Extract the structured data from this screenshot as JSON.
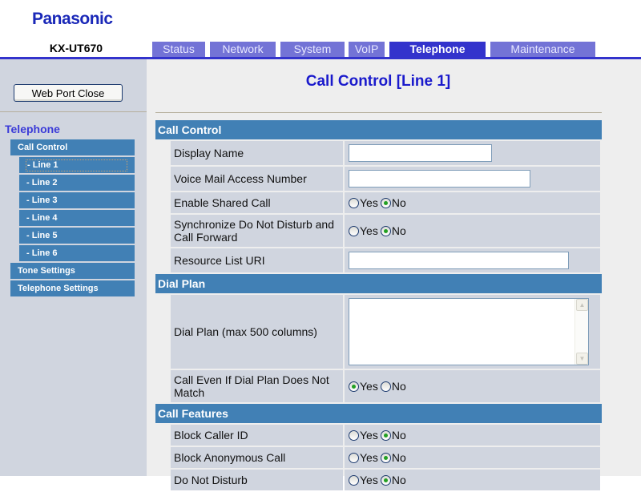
{
  "header": {
    "brand": "Panasonic",
    "model": "KX-UT670"
  },
  "tabs": [
    {
      "label": "Status",
      "active": false
    },
    {
      "label": "Network",
      "active": false
    },
    {
      "label": "System",
      "active": false
    },
    {
      "label": "VoIP",
      "active": false
    },
    {
      "label": "Telephone",
      "active": true
    },
    {
      "label": "Maintenance",
      "active": false
    }
  ],
  "sidebar": {
    "web_port_close": "Web Port Close",
    "section": "Telephone",
    "items": [
      {
        "label": "Call Control",
        "level": 0
      },
      {
        "label": "- Line 1",
        "level": 1,
        "current": true
      },
      {
        "label": "- Line 2",
        "level": 1
      },
      {
        "label": "- Line 3",
        "level": 1
      },
      {
        "label": "- Line 4",
        "level": 1
      },
      {
        "label": "- Line 5",
        "level": 1
      },
      {
        "label": "- Line 6",
        "level": 1
      },
      {
        "label": "Tone Settings",
        "level": 0
      },
      {
        "label": "Telephone Settings",
        "level": 0
      }
    ]
  },
  "page": {
    "title": "Call Control [Line 1]"
  },
  "radio_labels": {
    "yes": "Yes",
    "no": "No"
  },
  "sections": [
    {
      "title": "Call Control",
      "rows": [
        {
          "label": "Display Name",
          "type": "text",
          "value": ""
        },
        {
          "label": "Voice Mail Access Number",
          "type": "text",
          "value": ""
        },
        {
          "label": "Enable Shared Call",
          "type": "radio",
          "value": "No"
        },
        {
          "label": "Synchronize Do Not Disturb and Call Forward",
          "type": "radio",
          "value": "No"
        },
        {
          "label": "Resource List URI",
          "type": "text",
          "value": ""
        }
      ]
    },
    {
      "title": "Dial Plan",
      "rows": [
        {
          "label": "Dial Plan (max 500 columns)",
          "type": "textarea",
          "value": ""
        },
        {
          "label": "Call Even If Dial Plan Does Not Match",
          "type": "radio",
          "value": "Yes"
        }
      ]
    },
    {
      "title": "Call Features",
      "rows": [
        {
          "label": "Block Caller ID",
          "type": "radio",
          "value": "No"
        },
        {
          "label": "Block Anonymous Call",
          "type": "radio",
          "value": "No"
        },
        {
          "label": "Do Not Disturb",
          "type": "radio",
          "value": "No"
        }
      ]
    }
  ],
  "colors": {
    "tab_inactive": "#7373d6",
    "tab_active": "#3333cc",
    "section_header": "#4180b5",
    "row_bg": "#d0d5df",
    "title": "#1a1acc",
    "brand": "#1a28b8"
  }
}
